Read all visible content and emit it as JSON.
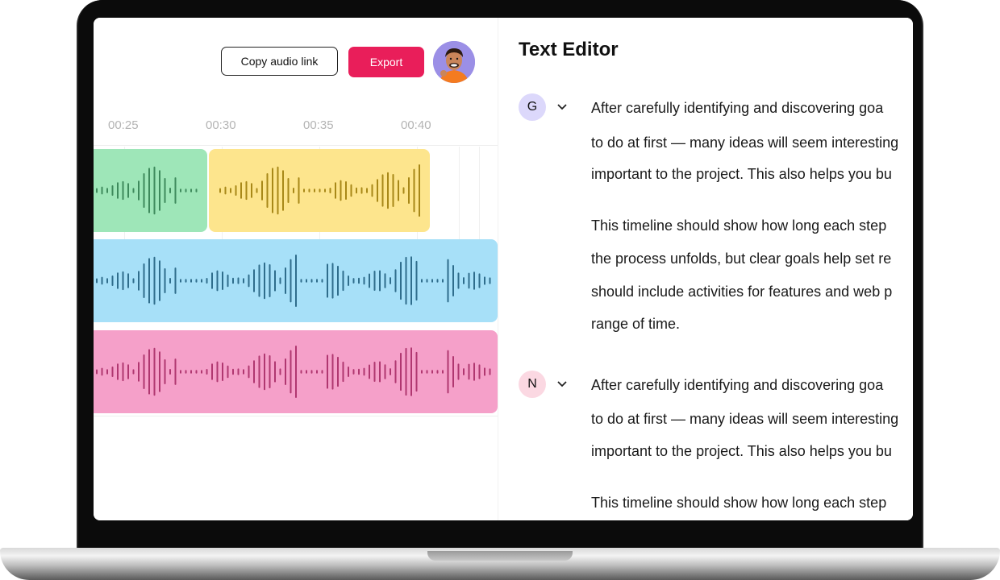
{
  "toolbar": {
    "copy_label": "Copy audio link",
    "export_label": "Export",
    "export_color": "#e91e5a"
  },
  "timeline": {
    "ticks": [
      "00:25",
      "00:30",
      "00:35",
      "00:40"
    ]
  },
  "tracks": [
    {
      "name": "green-clip",
      "color": "#9ee6b8",
      "wave_color": "#3e8a5c"
    },
    {
      "name": "yellow-clip",
      "color": "#fde58d",
      "wave_color": "#a88818"
    },
    {
      "name": "blue-track",
      "color": "#a7e0f8",
      "wave_color": "#2f6d8c"
    },
    {
      "name": "pink-track",
      "color": "#f5a0c9",
      "wave_color": "#b03770"
    }
  ],
  "editor": {
    "title": "Text Editor",
    "blocks": [
      {
        "speaker": "G",
        "speaker_color": "#dcd8fb",
        "paragraphs": [
          [
            "After carefully identifying and discovering goa",
            "to do at first — many ideas will seem interesting",
            "important to the project. This also helps you bu"
          ],
          [
            "This timeline should show how long each step",
            "the process unfolds, but clear goals help set re",
            "should include activities for features and web p",
            "range of time."
          ]
        ]
      },
      {
        "speaker": "N",
        "speaker_color": "#fbd8e2",
        "paragraphs": [
          [
            "After carefully identifying and discovering goa",
            "to do at first — many ideas will seem interesting",
            "important to the project. This also helps you bu"
          ],
          [
            "This timeline should show how long each step"
          ]
        ]
      }
    ]
  }
}
